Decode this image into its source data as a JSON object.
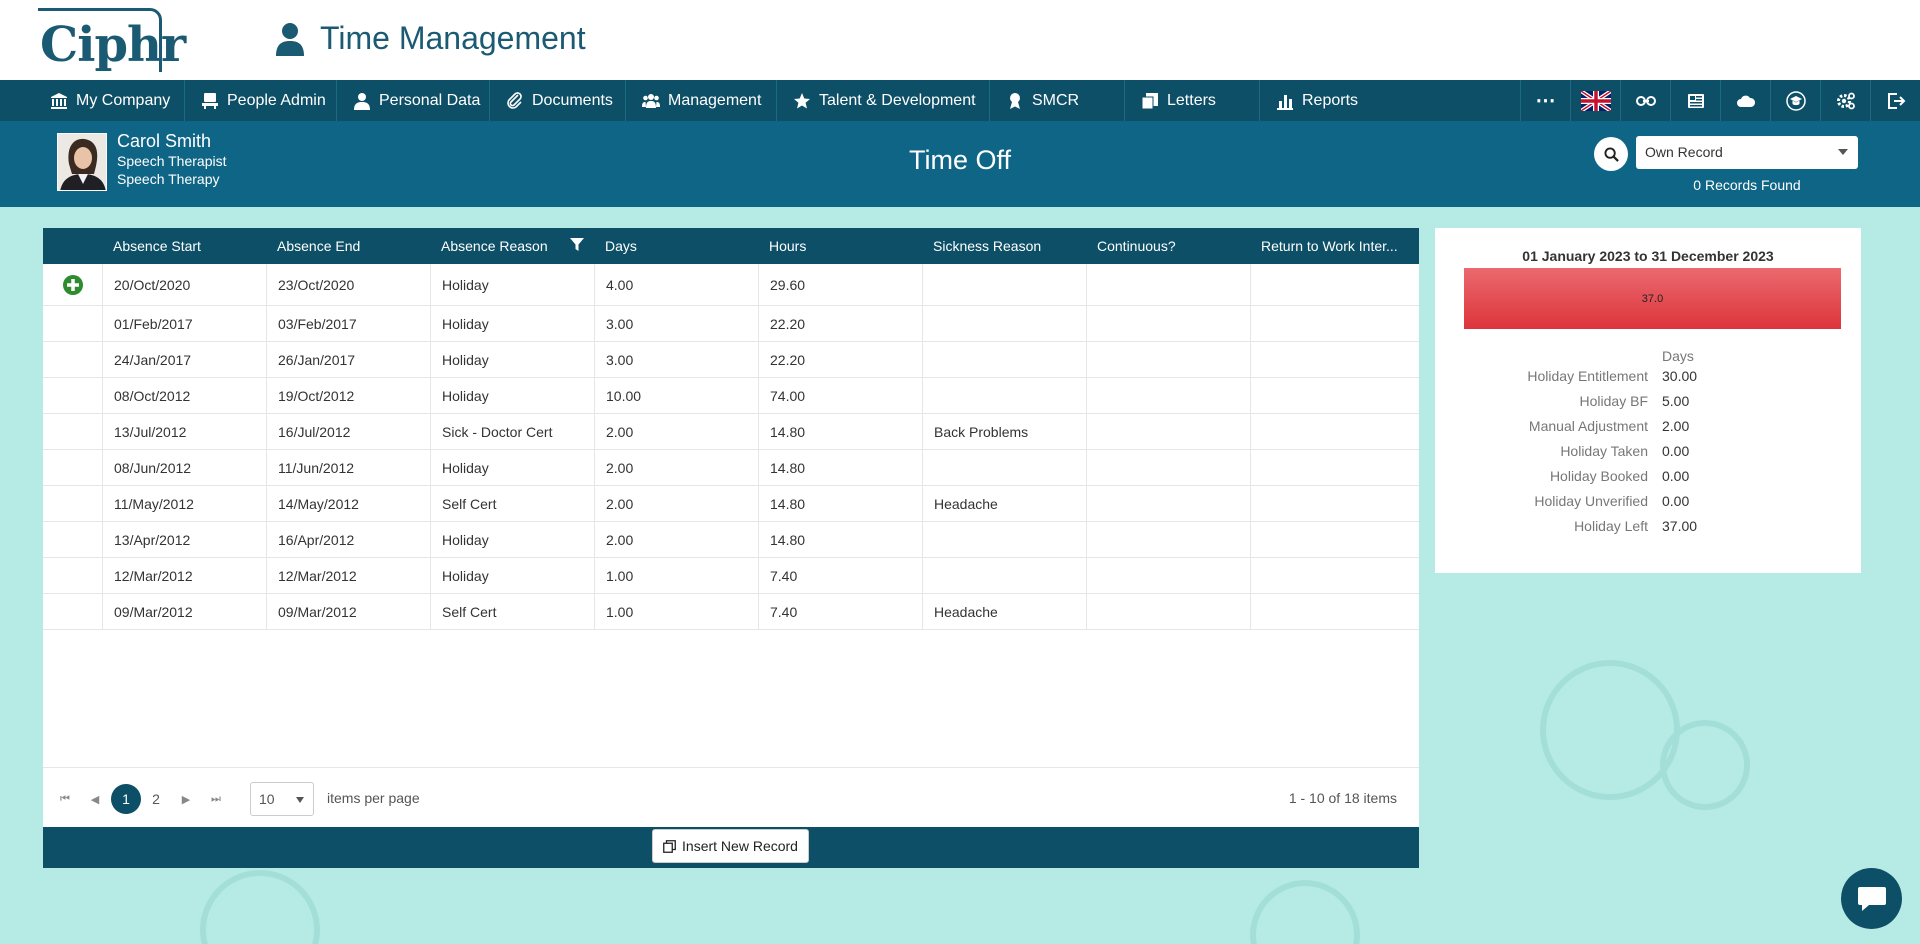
{
  "app": {
    "logo": "Ciphr",
    "title": "Time Management"
  },
  "nav": {
    "items": [
      {
        "label": "My Company",
        "icon": "bank-icon"
      },
      {
        "label": "People Admin",
        "icon": "desk-icon"
      },
      {
        "label": "Personal Data",
        "icon": "person-icon"
      },
      {
        "label": "Documents",
        "icon": "paperclip-icon"
      },
      {
        "label": "Management",
        "icon": "group-icon"
      },
      {
        "label": "Talent & Development",
        "icon": "star-icon"
      },
      {
        "label": "SMCR",
        "icon": "award-icon"
      },
      {
        "label": "Letters",
        "icon": "letters-icon"
      },
      {
        "label": "Reports",
        "icon": "bar-chart-icon"
      }
    ],
    "right_icons": [
      "more-icon",
      "uk-flag-icon",
      "link-icon",
      "newspaper-icon",
      "cloud-icon",
      "graduation-icon",
      "settings-icon",
      "logout-icon"
    ]
  },
  "record": {
    "name": "Carol Smith",
    "job_title": "Speech Therapist",
    "department": "Speech Therapy",
    "page_title": "Time Off",
    "selector_value": "Own Record",
    "records_found": "0 Records Found"
  },
  "grid": {
    "columns": [
      "",
      "Absence Start",
      "Absence End",
      "Absence Reason",
      "Days",
      "Hours",
      "Sickness Reason",
      "Continuous?",
      "Return to Work Inter..."
    ],
    "rows": [
      [
        "",
        "20/Oct/2020",
        "23/Oct/2020",
        "Holiday",
        "4.00",
        "29.60",
        "",
        "",
        ""
      ],
      [
        "",
        "01/Feb/2017",
        "03/Feb/2017",
        "Holiday",
        "3.00",
        "22.20",
        "",
        "",
        ""
      ],
      [
        "",
        "24/Jan/2017",
        "26/Jan/2017",
        "Holiday",
        "3.00",
        "22.20",
        "",
        "",
        ""
      ],
      [
        "",
        "08/Oct/2012",
        "19/Oct/2012",
        "Holiday",
        "10.00",
        "74.00",
        "",
        "",
        ""
      ],
      [
        "",
        "13/Jul/2012",
        "16/Jul/2012",
        "Sick - Doctor Cert",
        "2.00",
        "14.80",
        "Back Problems",
        "",
        ""
      ],
      [
        "",
        "08/Jun/2012",
        "11/Jun/2012",
        "Holiday",
        "2.00",
        "14.80",
        "",
        "",
        ""
      ],
      [
        "",
        "11/May/2012",
        "14/May/2012",
        "Self Cert",
        "2.00",
        "14.80",
        "Headache",
        "",
        ""
      ],
      [
        "",
        "13/Apr/2012",
        "16/Apr/2012",
        "Holiday",
        "2.00",
        "14.80",
        "",
        "",
        ""
      ],
      [
        "",
        "12/Mar/2012",
        "12/Mar/2012",
        "Holiday",
        "1.00",
        "7.40",
        "",
        "",
        ""
      ],
      [
        "",
        "09/Mar/2012",
        "09/Mar/2012",
        "Self Cert",
        "1.00",
        "7.40",
        "Headache",
        "",
        ""
      ]
    ],
    "pager": {
      "pages": [
        "1",
        "2"
      ],
      "current_page": "1",
      "page_size": "10",
      "items_per_page_label": "items per page",
      "info": "1 - 10 of 18 items"
    },
    "insert_label": "Insert New Record"
  },
  "summary": {
    "period": "01 January 2023 to 31 December 2023",
    "bar_value": "37.0",
    "bar_fill_fraction": 0.82,
    "bar_color": "#e2454b",
    "column_header": "Days",
    "stats": [
      {
        "label": "Holiday Entitlement",
        "value": "30.00"
      },
      {
        "label": "Holiday BF",
        "value": "5.00"
      },
      {
        "label": "Manual Adjustment",
        "value": "2.00"
      },
      {
        "label": "Holiday Taken",
        "value": "0.00"
      },
      {
        "label": "Holiday Booked",
        "value": "0.00"
      },
      {
        "label": "Holiday Unverified",
        "value": "0.00"
      },
      {
        "label": "Holiday Left",
        "value": "37.00"
      }
    ]
  },
  "colors": {
    "nav_bg": "#0d4f66",
    "header_bg": "#0e6586",
    "page_bg": "#b6ebe5",
    "add_green": "#2e8b2e"
  }
}
